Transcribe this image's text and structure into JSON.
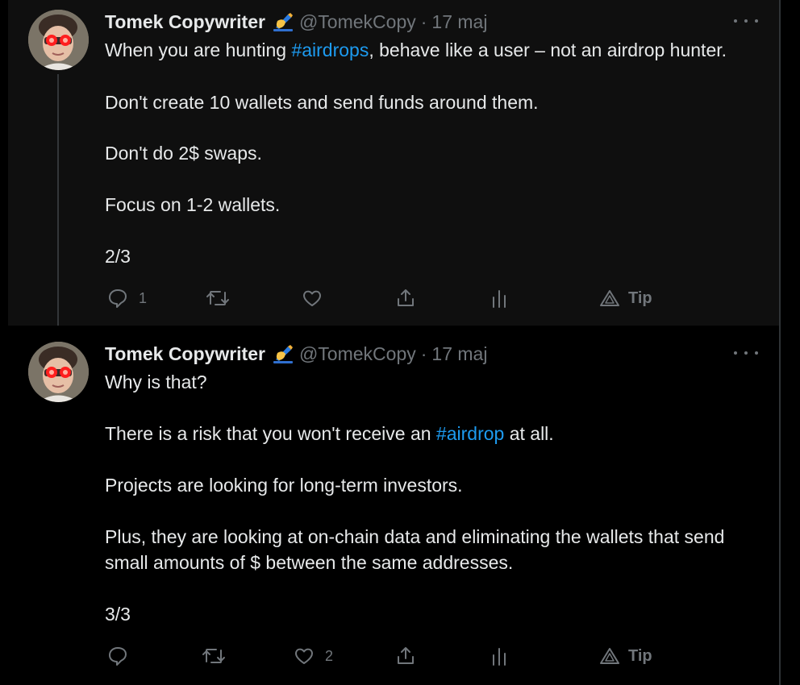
{
  "theme": {
    "background": "#000000",
    "highlighted_tweet_bg": "#0f0f0f",
    "text": "#e7e9ea",
    "muted": "#71767b",
    "hashtag": "#1d9bf0",
    "avatar_eyes": "#ff1e1e"
  },
  "tweets": [
    {
      "author": "Tomek Copywriter",
      "emoji": "✍️",
      "handle": "@TomekCopy",
      "separator": "·",
      "date": "17 maj",
      "line1_prefix": "When you are hunting ",
      "line1_hashtag": "#airdrops",
      "line1_suffix": ", behave like a user – not an airdrop hunter.",
      "line2": "Don't create 10 wallets and send funds around them.",
      "line3": "Don't do 2$ swaps.",
      "line4": "Focus on 1-2 wallets.",
      "line5": "2/3",
      "reply_count": "1",
      "retweet_count": "",
      "like_count": "",
      "tip_label": "Tip"
    },
    {
      "author": "Tomek Copywriter",
      "emoji": "✍️",
      "handle": "@TomekCopy",
      "separator": "·",
      "date": "17 maj",
      "line1": "Why is that?",
      "line2_prefix": "There is a risk that you won't receive an ",
      "line2_hashtag": "#airdrop",
      "line2_suffix": " at all.",
      "line3": "Projects are looking for long-term investors.",
      "line4": "Plus, they are looking at on-chain data and eliminating the wallets that send",
      "line5": "small amounts of $ between the same addresses.",
      "line6": "3/3",
      "reply_count": "",
      "retweet_count": "",
      "like_count": "2",
      "tip_label": "Tip"
    }
  ],
  "icons": {
    "more": "more-horizontal-icon",
    "reply": "reply-bubble-icon",
    "retweet": "retweet-arrows-icon",
    "like": "heart-icon",
    "share": "share-upload-icon",
    "analytics": "analytics-bars-icon",
    "tip": "tip-triangle-icon",
    "signature": "writing-hand-emoji"
  }
}
